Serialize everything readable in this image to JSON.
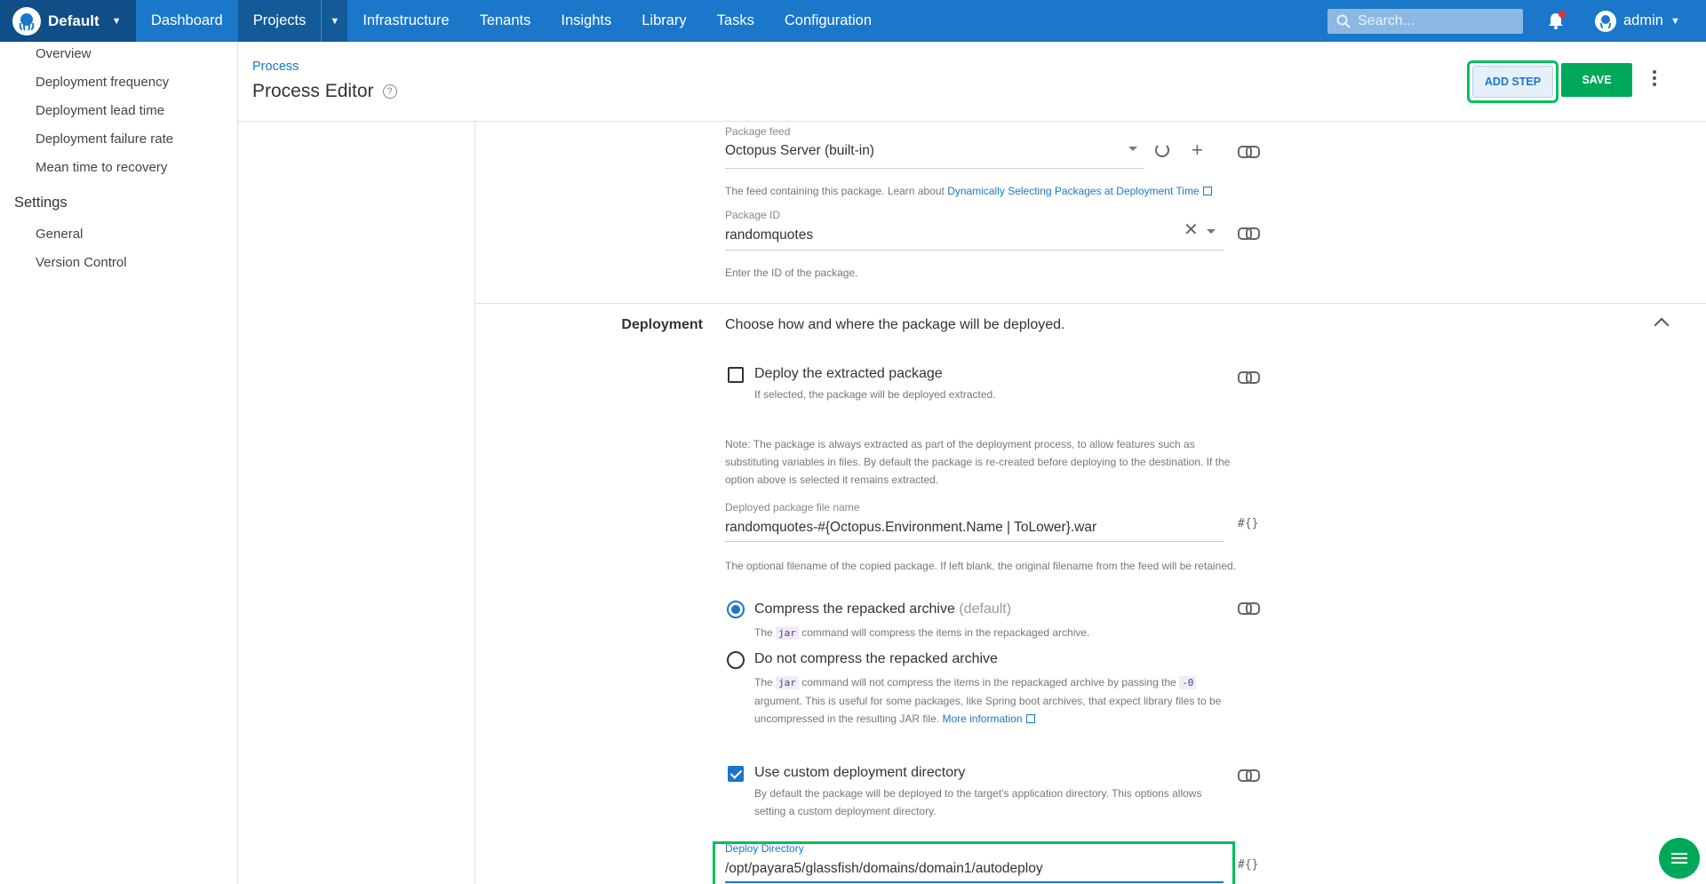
{
  "topnav": {
    "space": "Default",
    "items": [
      "Dashboard",
      "Projects",
      "Infrastructure",
      "Tenants",
      "Insights",
      "Library",
      "Tasks",
      "Configuration"
    ],
    "search_placeholder": "Search...",
    "user": "admin"
  },
  "sidebar": {
    "items": [
      "Overview",
      "Deployment frequency",
      "Deployment lead time",
      "Deployment failure rate",
      "Mean time to recovery"
    ],
    "settings_heading": "Settings",
    "settings_items": [
      "General",
      "Version Control"
    ]
  },
  "header": {
    "breadcrumb": "Process",
    "title": "Process Editor",
    "add_step": "ADD STEP",
    "save": "SAVE"
  },
  "package": {
    "feed_label": "Package feed",
    "feed_value": "Octopus Server (built-in)",
    "feed_help": "The feed containing this package. Learn about ",
    "feed_help_link": "Dynamically Selecting Packages at Deployment Time",
    "id_label": "Package ID",
    "id_value": "randomquotes",
    "id_help": "Enter the ID of the package."
  },
  "deployment": {
    "title": "Deployment",
    "description": "Choose how and where the package will be deployed.",
    "extract_label": "Deploy the extracted package",
    "extract_help": "If selected, the package will be deployed extracted.",
    "note": "Note: The package is always extracted as part of the deployment process, to allow features such as substituting variables in files. By default the package is re-created before deploying to the destination. If the option above is selected it remains extracted.",
    "filename_label": "Deployed package file name",
    "filename_value": "randomquotes-#{Octopus.Environment.Name | ToLower}.war",
    "filename_help": "The optional filename of the copied package. If left blank, the original filename from the feed will be retained.",
    "compress_label": "Compress the repacked archive",
    "compress_default": "(default)",
    "compress_help_pre": "The",
    "compress_help_code": "jar",
    "compress_help_post": "command will compress the items in the repackaged archive.",
    "nocompress_label": "Do not compress the repacked archive",
    "nocompress_help_pre": "The",
    "nocompress_help_code": "jar",
    "nocompress_help_mid": "command will not compress the items in the repackaged archive by passing the",
    "nocompress_help_code2": "-0",
    "nocompress_help_post": "argument. This is useful for some packages, like Spring boot archives, that expect library files to be uncompressed in the resulting JAR file.",
    "nocompress_link": "More information",
    "custom_dir_label": "Use custom deployment directory",
    "custom_dir_help": "By default the package will be deployed to the target's application directory. This options allows setting a custom deployment directory.",
    "deploy_dir_label": "Deploy Directory",
    "deploy_dir_value": "/opt/payara5/glassfish/domains/domain1/autodeploy"
  },
  "icons": {
    "var": "#{}"
  },
  "colors": {
    "nav": "#1a77ca",
    "accent_green": "#00a859",
    "highlight": "#00c05a"
  }
}
